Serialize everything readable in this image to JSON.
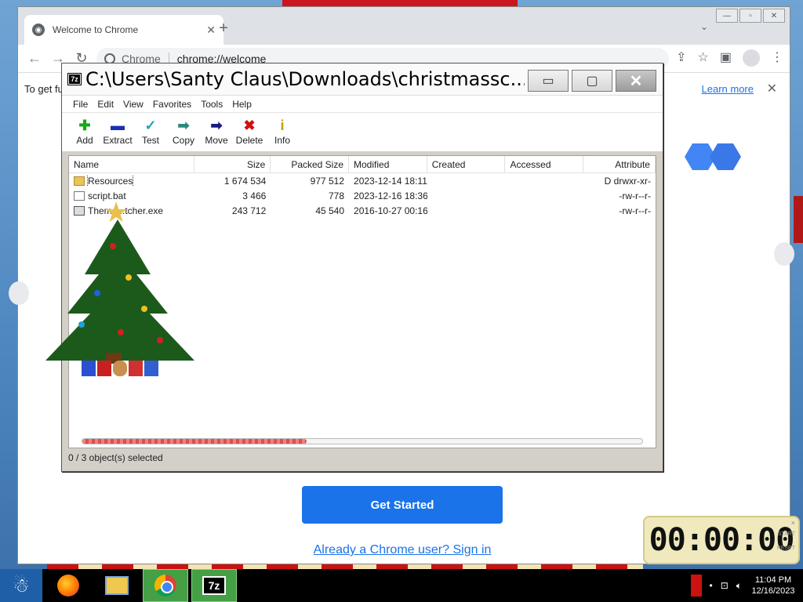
{
  "chrome": {
    "tab_title": "Welcome to Chrome",
    "omnibox_site": "Chrome",
    "omnibox_url": "chrome://welcome",
    "infobar_text": "To get fu",
    "infobar_link": "Learn more",
    "get_started": "Get Started",
    "signin_link": "Already a Chrome user? Sign in"
  },
  "zip": {
    "title": "C:\\Users\\Santy Claus\\Downloads\\christmassc...",
    "menu": [
      "File",
      "Edit",
      "View",
      "Favorites",
      "Tools",
      "Help"
    ],
    "toolbar": [
      {
        "label": "Add",
        "icon": "plus-icon",
        "glyph": "✚",
        "color": "#18a818"
      },
      {
        "label": "Extract",
        "icon": "minus-icon",
        "glyph": "▬",
        "color": "#1a2fb0"
      },
      {
        "label": "Test",
        "icon": "check-icon",
        "glyph": "✓",
        "color": "#22a0b0"
      },
      {
        "label": "Copy",
        "icon": "arrow-right-icon",
        "glyph": "➡",
        "color": "#2a8a7a"
      },
      {
        "label": "Move",
        "icon": "arrow-right-icon",
        "glyph": "➡",
        "color": "#1a1a80"
      },
      {
        "label": "Delete",
        "icon": "x-icon",
        "glyph": "✖",
        "color": "#d01010"
      },
      {
        "label": "Info",
        "icon": "info-icon",
        "glyph": "i",
        "color": "#c0a000"
      }
    ],
    "columns": [
      "Name",
      "Size",
      "Packed Size",
      "Modified",
      "Created",
      "Accessed",
      "Attribute"
    ],
    "rows": [
      {
        "name": "Resources",
        "icon": "folder",
        "size": "1 674 534",
        "packed": "977 512",
        "modified": "2023-12-14 18:11",
        "created": "",
        "accessed": "",
        "attr": "D drwxr-xr-"
      },
      {
        "name": "script.bat",
        "icon": "bat",
        "size": "3 466",
        "packed": "778",
        "modified": "2023-12-16 18:36",
        "created": "",
        "accessed": "",
        "attr": "-rw-r--r-"
      },
      {
        "name": "Theme...tcher.exe",
        "icon": "exe",
        "size": "243 712",
        "packed": "45 540",
        "modified": "2016-10-27 00:16",
        "created": "",
        "accessed": "",
        "attr": "-rw-r--r-"
      }
    ],
    "progress_fraction": 0.4,
    "status": "0 / 3 object(s) selected"
  },
  "taskbar": {
    "time": "11:04 PM",
    "date": "12/16/2023",
    "app_7z_label": "7z"
  },
  "timer": {
    "display": "00:00:00",
    "close": "×",
    "start": "START",
    "reset": "RESET"
  }
}
